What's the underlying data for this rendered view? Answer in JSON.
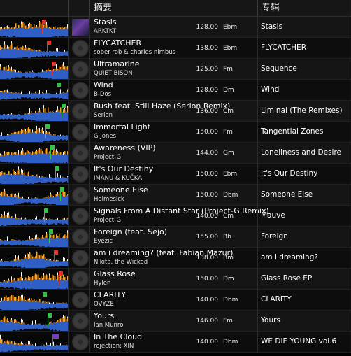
{
  "header": {
    "summary_label": "摘要",
    "album_label": "专辑"
  },
  "colors": {
    "wave_blue": "#2f5fc4",
    "wave_orange": "#f0a43a",
    "wave_white": "#ffffff",
    "flag_red": "#e0342c",
    "flag_green": "#35c14a",
    "flag_purple": "#7a3cc8"
  },
  "tracks": [
    {
      "title": "Stasis",
      "artist": "ARKTKT",
      "bpm": "128.00",
      "key": "Ebm",
      "album": "Stasis",
      "flag": "red",
      "art": "cover"
    },
    {
      "title": "FLYCATCHER",
      "artist": "sober rob & charles nimbus",
      "bpm": "138.00",
      "key": "Ebm",
      "album": "FLYCATCHER",
      "flag": "red",
      "art": "disc"
    },
    {
      "title": "Ultramarine",
      "artist": "QUIET BISON",
      "bpm": "125.00",
      "key": "Fm",
      "album": "Sequence",
      "flag": "red",
      "art": "disc"
    },
    {
      "title": "Wind",
      "artist": "B-Dos",
      "bpm": "128.00",
      "key": "Dm",
      "album": "Wind",
      "flag": "green",
      "art": "disc"
    },
    {
      "title": "Rush feat. Still Haze (Serion Remix)",
      "artist": "Serion",
      "bpm": "136.00",
      "key": "Cm",
      "album": "Liminal (The Remixes)",
      "flag": "green",
      "art": "disc"
    },
    {
      "title": "Immortal Light",
      "artist": "G Jones",
      "bpm": "150.00",
      "key": "Fm",
      "album": "Tangential Zones",
      "flag": "green",
      "art": "disc"
    },
    {
      "title": "Awareness (VIP)",
      "artist": "Project-G",
      "bpm": "144.00",
      "key": "Gm",
      "album": "Loneliness and Desire",
      "flag": "green",
      "art": "disc"
    },
    {
      "title": "It's Our Destiny",
      "artist": "IMANU & KUČKA",
      "bpm": "150.00",
      "key": "Ebm",
      "album": "It's Our Destiny",
      "flag": "green",
      "art": "disc"
    },
    {
      "title": "Someone Else",
      "artist": "Holmesick",
      "bpm": "150.00",
      "key": "Dbm",
      "album": "Someone Else",
      "flag": "green",
      "art": "disc"
    },
    {
      "title": "Signals From A Distant Star (Project-G Remix)",
      "artist": "Project-G",
      "bpm": "140.00",
      "key": "Cm",
      "album": "Mauve",
      "flag": "green",
      "art": "disc"
    },
    {
      "title": "Foreign (feat. Sejo)",
      "artist": "Eyezic",
      "bpm": "155.00",
      "key": "Bb",
      "album": "Foreign",
      "flag": "green",
      "art": "disc"
    },
    {
      "title": "am i dreaming? (feat. Fabian Mazur)",
      "artist": "Nikita, the Wicked",
      "bpm": "138.00",
      "key": "Bm",
      "album": "am i dreaming?",
      "flag": "red",
      "art": "disc"
    },
    {
      "title": "Glass Rose",
      "artist": "Hylen",
      "bpm": "150.00",
      "key": "Dm",
      "album": "Glass Rose EP",
      "flag": "red",
      "art": "disc"
    },
    {
      "title": "CLARITY",
      "artist": "OVYZE",
      "bpm": "140.00",
      "key": "Dbm",
      "album": "CLARITY",
      "flag": "green",
      "art": "disc"
    },
    {
      "title": "Yours",
      "artist": "Ian Munro",
      "bpm": "146.00",
      "key": "Fm",
      "album": "Yours",
      "flag": "green",
      "art": "disc"
    },
    {
      "title": "In The Cloud",
      "artist": "rejection; XIN",
      "bpm": "140.00",
      "key": "Dbm",
      "album": "WE DIE YOUNG vol.6",
      "flag": "purple",
      "art": "disc"
    }
  ]
}
